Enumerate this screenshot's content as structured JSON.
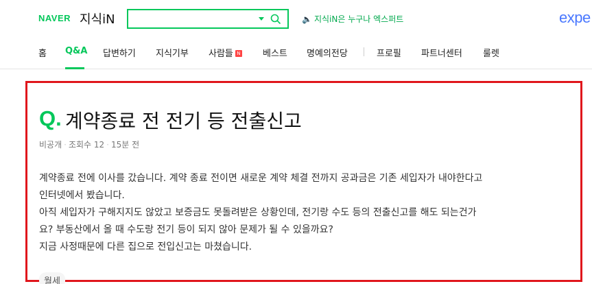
{
  "header": {
    "naver_logo": "NAVER",
    "service_name": "지식iN",
    "search": {
      "value": "",
      "placeholder": ""
    },
    "promo_text": "지식iN은 누구나 엑스퍼트",
    "expert_logo": "expe"
  },
  "nav": {
    "items": [
      {
        "label": "홈"
      },
      {
        "label": "Q&A"
      },
      {
        "label": "답변하기"
      },
      {
        "label": "지식기부"
      },
      {
        "label": "사람들",
        "badge": "N"
      },
      {
        "label": "베스트"
      },
      {
        "label": "명예의전당"
      },
      {
        "label": "프로필"
      },
      {
        "label": "파트너센터"
      },
      {
        "label": "룰렛"
      }
    ],
    "active": "Q&A"
  },
  "question": {
    "mark": "Q.",
    "title": "계약종료 전 전기 등 전출신고",
    "author": "비공개",
    "views": "조회수 12",
    "time": "15분 전",
    "body": [
      "계약종료 전에 이사를 갔습니다. 계약 종료 전이면 새로운 계약 체결 전까지 공과금은 기존 세입자가 내야한다고",
      "인터넷에서 봤습니다.",
      "아직 세입자가 구해지지도 않았고 보증금도 못돌려받은 상황인데, 전기랑 수도 등의 전출신고를 해도 되는건가",
      "요? 부동산에서 올 때 수도랑 전기 등이 되지 않아 문제가 될 수 있을까요?",
      "지금 사정때문에 다른 집으로 전입신고는 마쳤습니다."
    ],
    "tag": "월세"
  },
  "colors": {
    "brand_green": "#03c75a",
    "highlight_border": "#e0161c",
    "expert_blue": "#4a78ff"
  }
}
